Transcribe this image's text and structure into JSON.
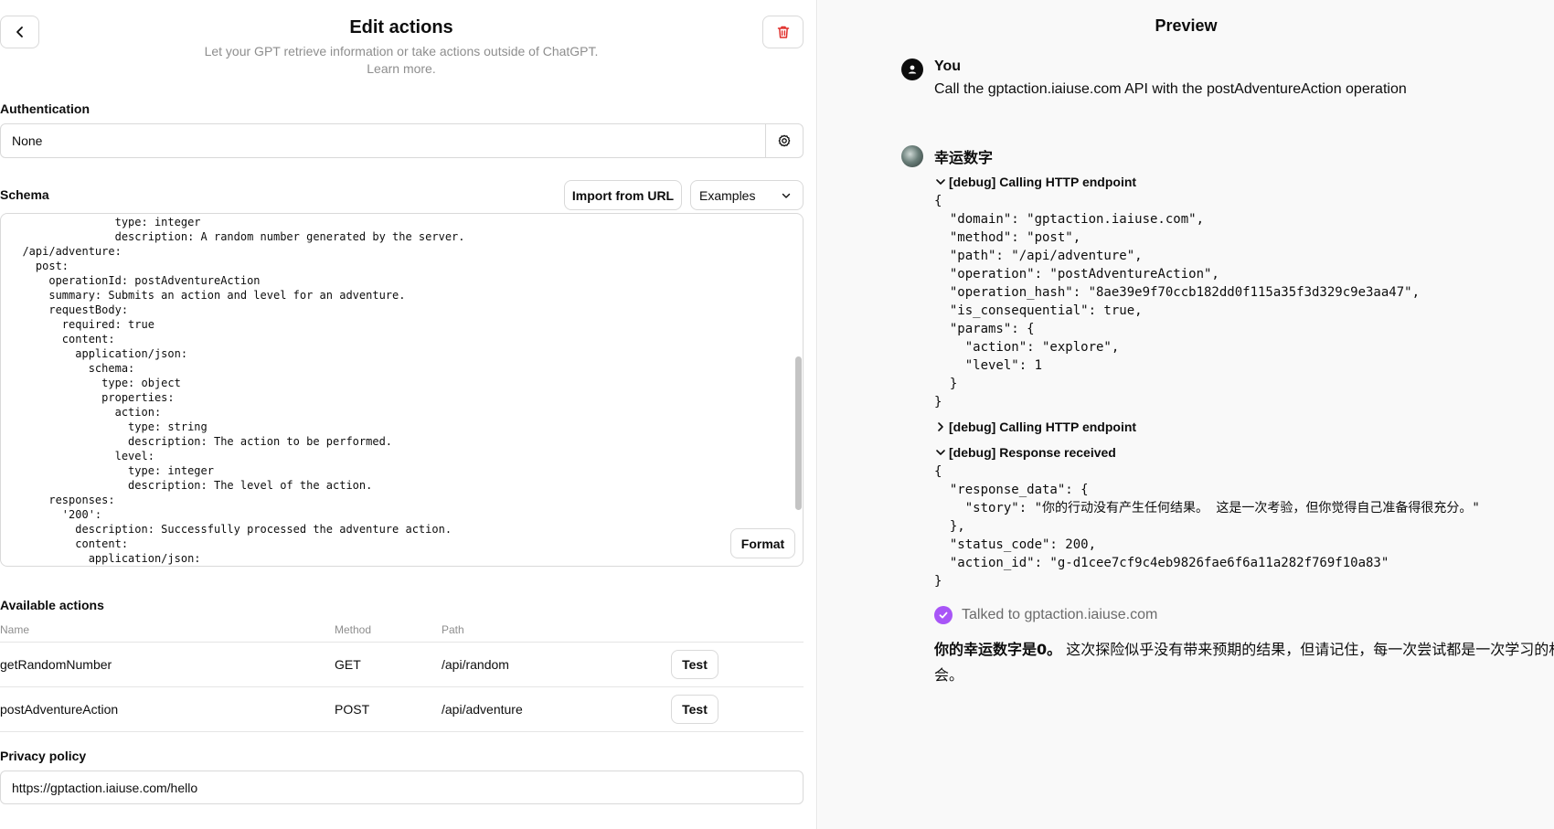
{
  "editor": {
    "title": "Edit actions",
    "subtitle": "Let your GPT retrieve information or take actions outside of ChatGPT.",
    "learn_more": "Learn more.",
    "auth_label": "Authentication",
    "auth_value": "None",
    "schema_label": "Schema",
    "import_label": "Import from URL",
    "examples_label": "Examples",
    "format_label": "Format",
    "schema_text": "                type: integer\n                description: A random number generated by the server.\n  /api/adventure:\n    post:\n      operationId: postAdventureAction\n      summary: Submits an action and level for an adventure.\n      requestBody:\n        required: true\n        content:\n          application/json:\n            schema:\n              type: object\n              properties:\n                action:\n                  type: string\n                  description: The action to be performed.\n                level:\n                  type: integer\n                  description: The level of the action.\n      responses:\n        '200':\n          description: Successfully processed the adventure action.\n          content:\n            application/json:",
    "actions_label": "Available actions",
    "columns": [
      "Name",
      "Method",
      "Path"
    ],
    "actions": [
      {
        "name": "getRandomNumber",
        "method": "GET",
        "path": "/api/random",
        "test": "Test"
      },
      {
        "name": "postAdventureAction",
        "method": "POST",
        "path": "/api/adventure",
        "test": "Test"
      }
    ],
    "privacy_label": "Privacy policy",
    "privacy_url": "https://gptaction.iaiuse.com/hello"
  },
  "preview": {
    "title": "Preview",
    "user_name": "You",
    "user_message": "Call the gptaction.iaiuse.com API with the postAdventureAction operation",
    "gpt_name": "幸运数字",
    "debug1_label": "[debug] Calling HTTP endpoint",
    "debug1_body": "{\n  \"domain\": \"gptaction.iaiuse.com\",\n  \"method\": \"post\",\n  \"path\": \"/api/adventure\",\n  \"operation\": \"postAdventureAction\",\n  \"operation_hash\": \"8ae39e9f70ccb182dd0f115a35f3d329c9e3aa47\",\n  \"is_consequential\": true,\n  \"params\": {\n    \"action\": \"explore\",\n    \"level\": 1\n  }\n}",
    "debug2_label": "[debug] Calling HTTP endpoint",
    "debug3_label": "[debug] Response received",
    "debug3_body": "{\n  \"response_data\": {\n    \"story\": \"你的行动没有产生任何结果。 这是一次考验，但你觉得自己准备得很充分。\"\n  },\n  \"status_code\": 200,\n  \"action_id\": \"g-d1cee7cf9c4eb9826fae6f6a11a282f769f10a83\"\n}",
    "talked_text": "Talked to gptaction.iaiuse.com",
    "final_bold": "你的幸运数字是0。",
    "final_text": "这次探险似乎没有带来预期的结果，但请记住，每一次尝试都是一次学习的机会。"
  }
}
